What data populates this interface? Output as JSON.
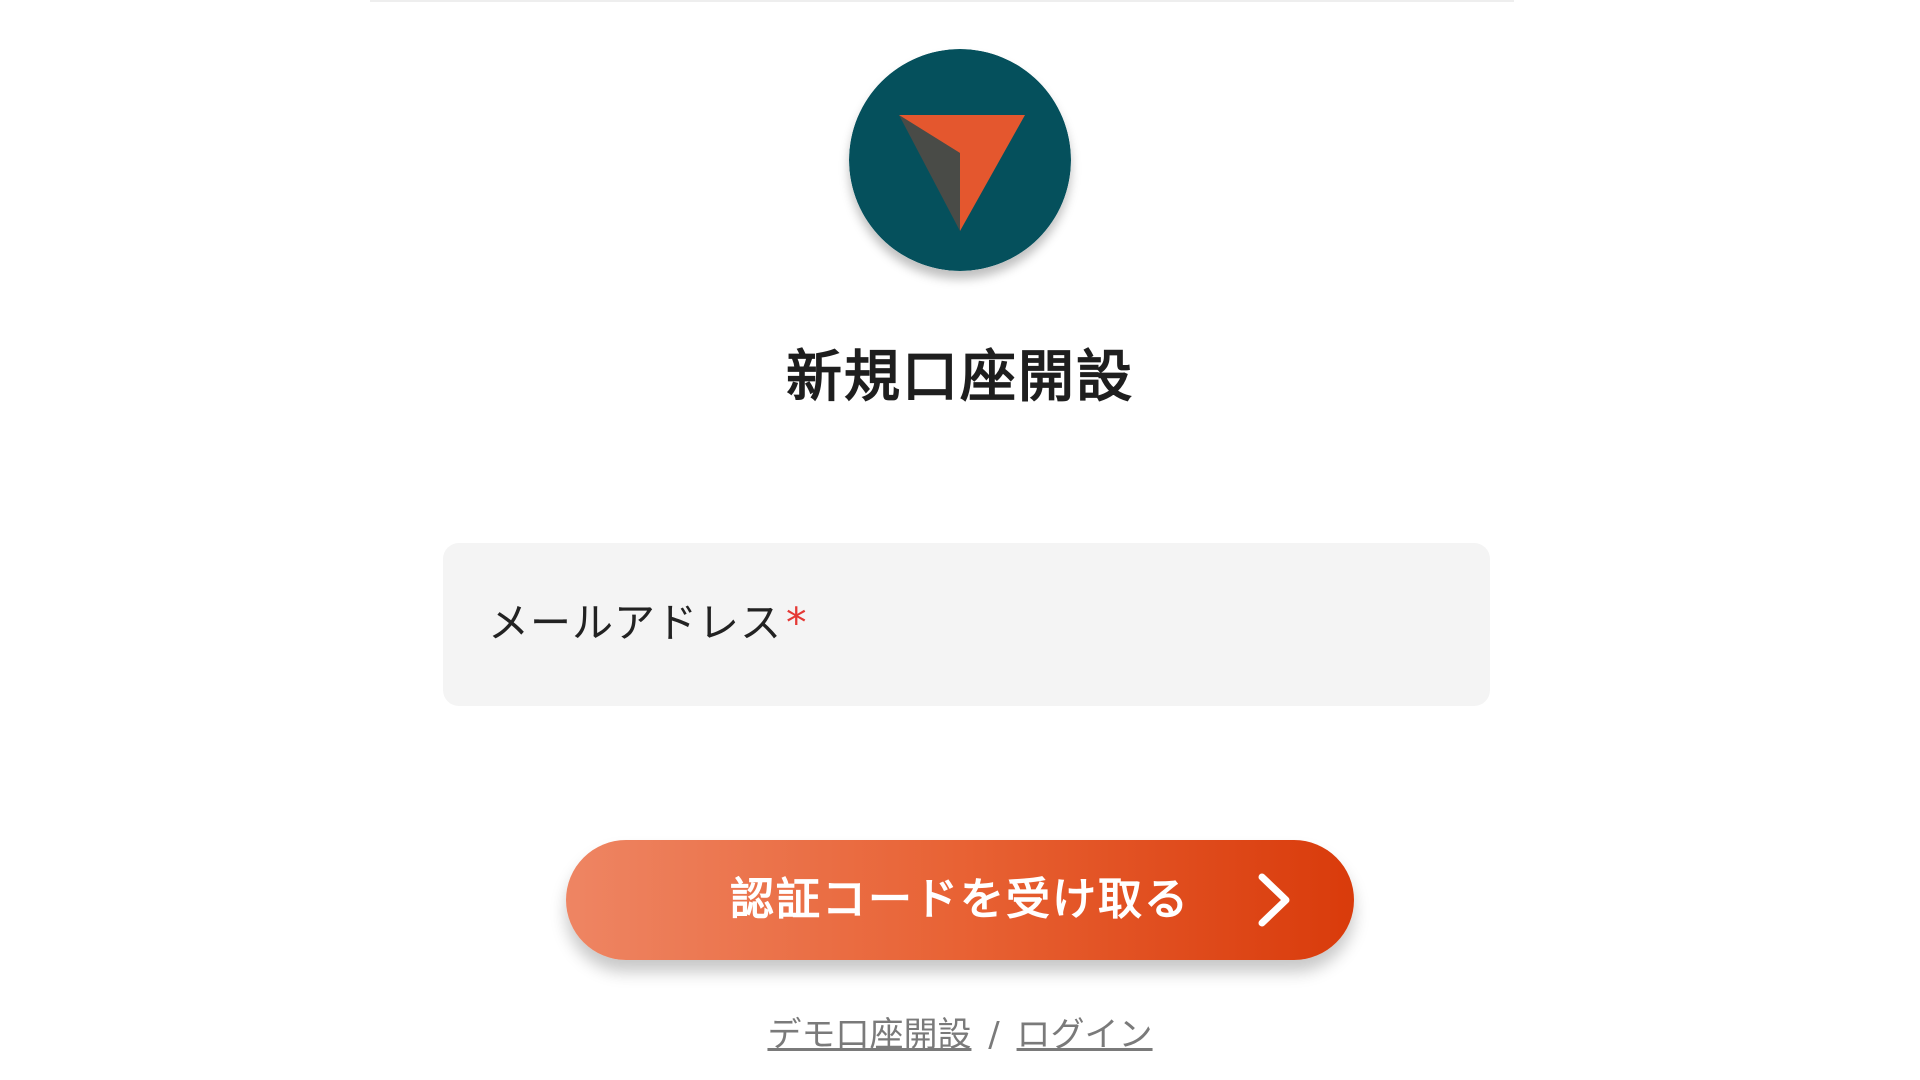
{
  "colors": {
    "brand_dark": "#05505c",
    "brand_accent": "#e4572e",
    "button_gradient_start": "#ee8563",
    "button_gradient_end": "#d93b0b",
    "required": "#e53935",
    "field_background": "#f4f4f4"
  },
  "logo": {
    "icon": "send-arrow-logo"
  },
  "title": "新規口座開設",
  "email_field": {
    "label": "メールアドレス",
    "required_mark": "*",
    "value": ""
  },
  "submit_button": {
    "label": "認証コードを受け取る",
    "icon": "chevron-right-icon"
  },
  "footer": {
    "demo_link": "デモ口座開設",
    "separator": "/",
    "login_link": "ログイン"
  }
}
